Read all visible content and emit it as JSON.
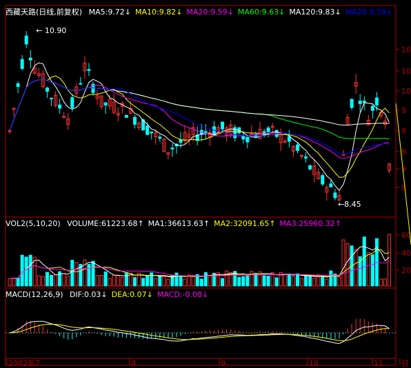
{
  "stock": {
    "name": "西藏天路",
    "mode": "(日线,前复权)"
  },
  "colors": {
    "bg": "#000000",
    "up": "#ff3232",
    "down": "#00ffff",
    "frame": "#b00000",
    "ma5": "#ffffff",
    "ma10": "#ffff00",
    "ma20": "#ff00ff",
    "ma60": "#00ff00",
    "ma120": "#ffffff",
    "ma_blue": "#0000ff",
    "dif": "#ffffff",
    "dea": "#ffff00",
    "macd": "#ff00ff"
  },
  "price_header": [
    {
      "label": "MA5:9.72",
      "arrow": "↓",
      "color": "#ffffff"
    },
    {
      "label": "MA10:9.82",
      "arrow": "↓",
      "color": "#ffff00"
    },
    {
      "label": "MA20:9.59",
      "arrow": "↓",
      "color": "#ff00ff"
    },
    {
      "label": "MA60:9.63",
      "arrow": "↓",
      "color": "#00ff00"
    },
    {
      "label": "MA120:9.83",
      "arrow": "↓",
      "color": "#ffffff"
    },
    {
      "label": "MA20:9.59",
      "arrow": "↓",
      "color": "#0000ff"
    }
  ],
  "volume_header": {
    "title": "VOL2(5,10,20)",
    "items": [
      {
        "label": "VOLUME:61223.68",
        "arrow": "↑",
        "color": "#ffffff"
      },
      {
        "label": "MA1:36613.63",
        "arrow": "↑",
        "color": "#ffffff"
      },
      {
        "label": "MA2:32091.65",
        "arrow": "↑",
        "color": "#ffff00"
      },
      {
        "label": "MA3:25960.32",
        "arrow": "↑",
        "color": "#ff00ff"
      }
    ]
  },
  "macd_header": {
    "title": "MACD(12,26,9)",
    "items": [
      {
        "label": "DIF:0.03",
        "arrow": "↓",
        "color": "#ffffff"
      },
      {
        "label": "DEA:0.07",
        "arrow": "↓",
        "color": "#ffff00"
      },
      {
        "label": "MACD:-0.08",
        "arrow": "↓",
        "color": "#ff00ff"
      }
    ]
  },
  "chart_data": {
    "type": "candlestick",
    "annotations": {
      "high": "10.90",
      "low": "8.45"
    },
    "price_axis_labels": [
      "10",
      "10",
      "10",
      "9",
      "9",
      "9",
      "9",
      "8"
    ],
    "volume_axis_labels": [
      "60",
      "40",
      "20"
    ],
    "x_axis_labels": [
      "2002年7",
      "8",
      "9",
      "10",
      "11",
      "日"
    ]
  }
}
